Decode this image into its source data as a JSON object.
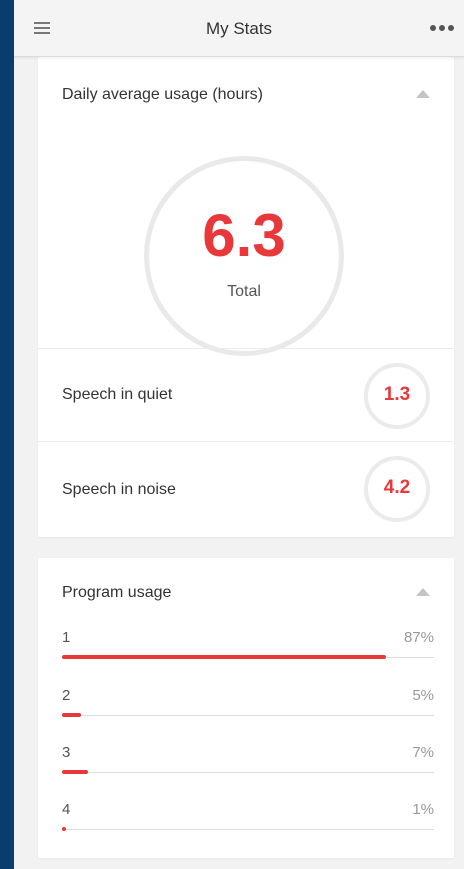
{
  "header": {
    "title": "My Stats"
  },
  "daily_usage": {
    "title": "Daily average usage (hours)",
    "total_value": "6.3",
    "total_label": "Total",
    "rows": [
      {
        "label": "Speech in quiet",
        "value": "1.3"
      },
      {
        "label": "Speech in noise",
        "value": "4.2"
      }
    ]
  },
  "program_usage": {
    "title": "Program usage",
    "programs": [
      {
        "name": "1",
        "percent_label": "87%",
        "percent": 87
      },
      {
        "name": "2",
        "percent_label": "5%",
        "percent": 5
      },
      {
        "name": "3",
        "percent_label": "7%",
        "percent": 7
      },
      {
        "name": "4",
        "percent_label": "1%",
        "percent": 1
      }
    ]
  },
  "colors": {
    "accent": "#e8383a",
    "frame": "#0a3d6e"
  }
}
